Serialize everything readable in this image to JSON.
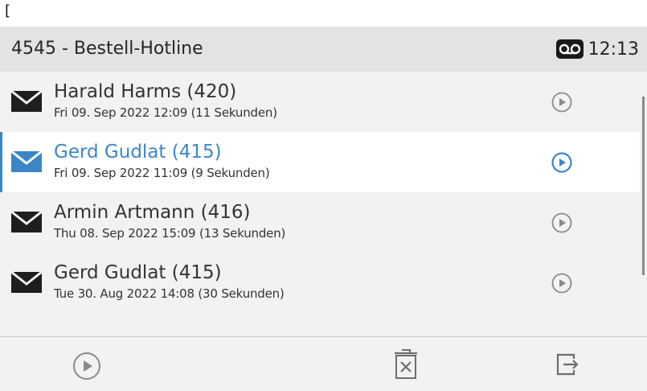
{
  "bracket": "[",
  "header": {
    "title": "4545 - Bestell-Hotline",
    "clock": "12:13",
    "icon": "voicemail-icon"
  },
  "messages": [
    {
      "name": "Harald Harms (420)",
      "date": "Fri 09. Sep 2022 12:09 (11 Sekunden)",
      "selected": false
    },
    {
      "name": "Gerd Gudlat (415)",
      "date": "Fri 09. Sep 2022 11:09 (9 Sekunden)",
      "selected": true
    },
    {
      "name": "Armin Artmann (416)",
      "date": "Thu 08. Sep 2022 15:09 (13 Sekunden)",
      "selected": false
    },
    {
      "name": "Gerd Gudlat (415)",
      "date": "Tue 30. Aug 2022 14:08 (30 Sekunden)",
      "selected": false
    }
  ],
  "footer": {
    "icons": [
      "play-icon",
      "delete-icon",
      "exit-icon"
    ]
  },
  "colors": {
    "accent": "#3d86c6",
    "header_bg": "#e3e3e3",
    "list_bg": "#f2f2f2",
    "icon_gray": "#8a8a8a"
  }
}
